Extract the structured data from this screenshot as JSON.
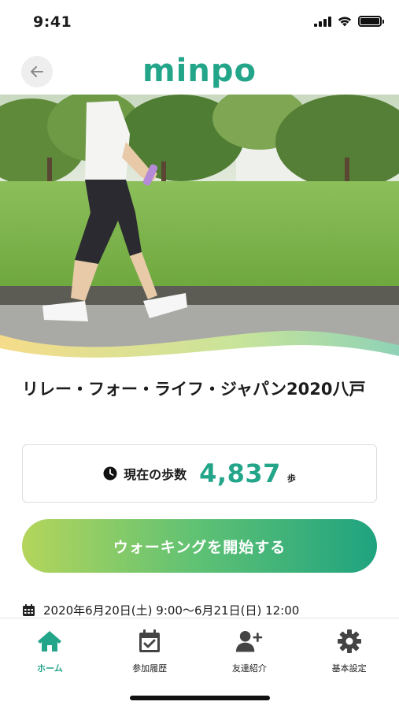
{
  "status_bar": {
    "time": "9:41"
  },
  "header": {
    "logo": "minpo",
    "back_icon": "arrow-left-icon"
  },
  "event": {
    "title": "リレー・フォー・ライフ・ジャパン2020八戸",
    "date": "2020年6月20日(土) 9:00〜6月21日(日) 12:00"
  },
  "steps": {
    "label": "現在の歩数",
    "value": "4,837",
    "unit": "歩"
  },
  "start_button": {
    "label": "ウォーキングを開始する"
  },
  "bottom_nav": {
    "items": [
      {
        "label": "ホーム",
        "icon": "home-icon",
        "active": true
      },
      {
        "label": "参加履歴",
        "icon": "calendar-check-icon",
        "active": false
      },
      {
        "label": "友達紹介",
        "icon": "user-plus-icon",
        "active": false
      },
      {
        "label": "基本設定",
        "icon": "gear-icon",
        "active": false
      }
    ]
  },
  "colors": {
    "accent": "#23a58a",
    "button_gradient_start": "#b4d55b",
    "button_gradient_end": "#1fa37f",
    "nav_active": "#23a58a"
  }
}
